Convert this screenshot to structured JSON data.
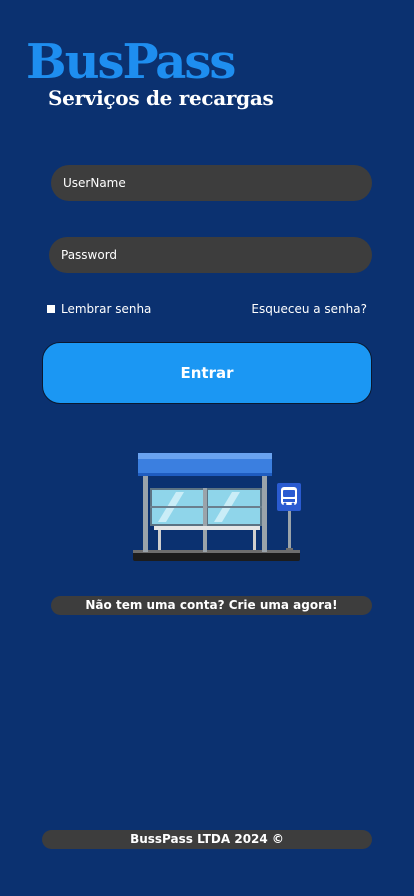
{
  "brand": {
    "logo_text": "BusPass",
    "subtitle": "Serviços de recargas"
  },
  "login": {
    "username_placeholder": "UserName",
    "password_placeholder": "Password",
    "remember_label": "Lembrar senha",
    "forgot_label": "Esqueceu a senha?",
    "submit_label": "Entrar"
  },
  "illustration": {
    "icon": "bus-stop-icon"
  },
  "signup": {
    "label": "Não tem uma conta? Crie uma agora!"
  },
  "footer": {
    "text": "BussPass LTDA 2024 ©"
  },
  "colors": {
    "background": "#0b3170",
    "accent": "#1b97f3",
    "logo": "#1e8ef0",
    "field": "#3d3d3d"
  }
}
